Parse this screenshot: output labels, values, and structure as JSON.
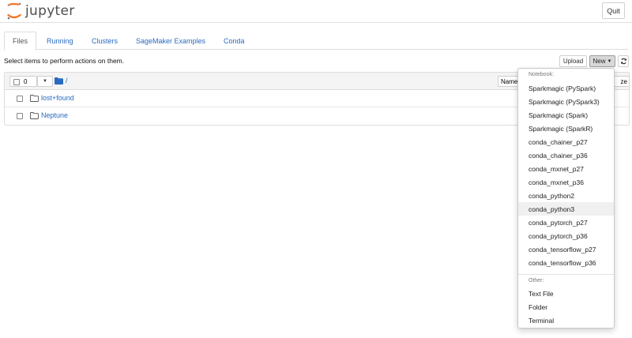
{
  "app": {
    "logo_text": "jupyter",
    "quit_label": "Quit",
    "brand_color": "#f37726"
  },
  "tabs": [
    {
      "label": "Files",
      "active": true
    },
    {
      "label": "Running",
      "active": false
    },
    {
      "label": "Clusters",
      "active": false
    },
    {
      "label": "SageMaker Examples",
      "active": false
    },
    {
      "label": "Conda",
      "active": false
    }
  ],
  "toolbar": {
    "instruction": "Select items to perform actions on them.",
    "upload_label": "Upload",
    "new_label": "New",
    "refresh_icon": "refresh-icon"
  },
  "list": {
    "selected_count": "0",
    "breadcrumb": "/",
    "name_sort_label": "Name",
    "size_sort_label": "ze",
    "items": [
      {
        "name": "lost+found",
        "type": "folder"
      },
      {
        "name": "Neptune",
        "type": "folder"
      }
    ]
  },
  "new_menu": {
    "notebook_header": "Notebook:",
    "notebook_kernels": [
      "Sparkmagic (PySpark)",
      "Sparkmagic (PySpark3)",
      "Sparkmagic (Spark)",
      "Sparkmagic (SparkR)",
      "conda_chainer_p27",
      "conda_chainer_p36",
      "conda_mxnet_p27",
      "conda_mxnet_p36",
      "conda_python2",
      "conda_python3",
      "conda_pytorch_p27",
      "conda_pytorch_p36",
      "conda_tensorflow_p27",
      "conda_tensorflow_p36"
    ],
    "hovered_item": "conda_python3",
    "other_header": "Other:",
    "other_items": [
      "Text File",
      "Folder",
      "Terminal"
    ]
  },
  "colors": {
    "link": "#2a6ac0",
    "folder_icon": "#2a6ac0"
  }
}
